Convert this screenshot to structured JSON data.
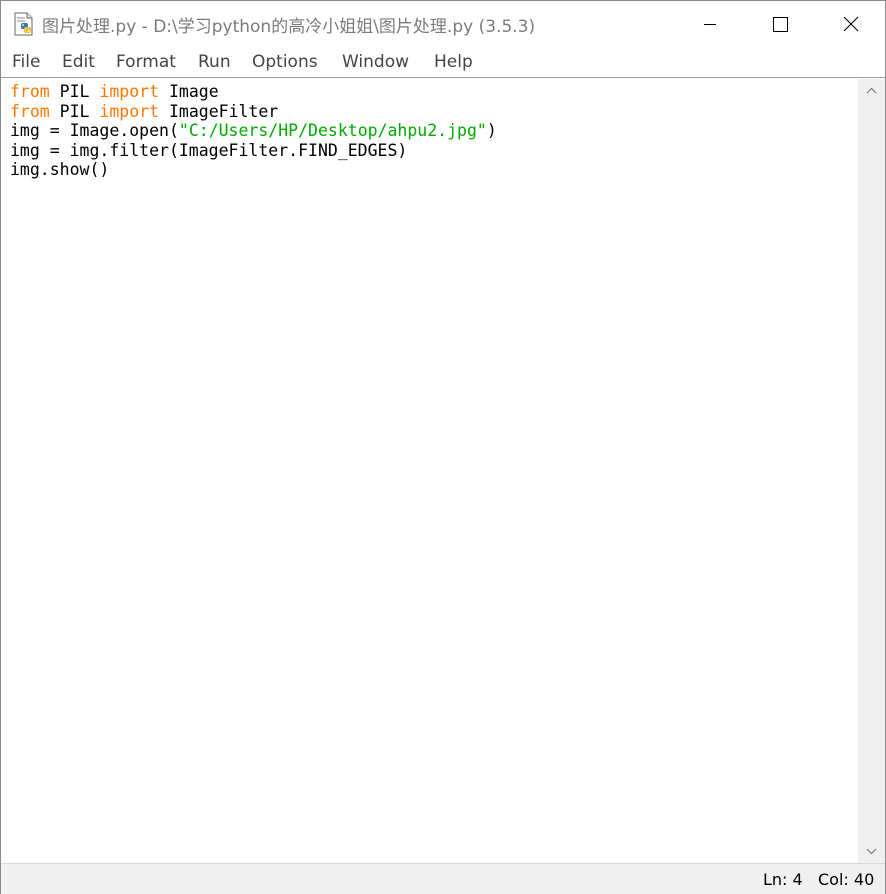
{
  "window": {
    "title": "图片处理.py - D:\\学习python的高冷小姐姐\\图片处理.py (3.5.3)",
    "app_icon": "python-idle-file-icon",
    "controls": {
      "minimize_icon": "minimize-icon",
      "maximize_icon": "maximize-icon",
      "close_icon": "close-icon"
    }
  },
  "menu": {
    "items": [
      "File",
      "Edit",
      "Format",
      "Run",
      "Options",
      "Window",
      "Help"
    ]
  },
  "editor": {
    "lines": [
      [
        {
          "t": "from",
          "c": "kw"
        },
        {
          "t": " PIL ",
          "c": ""
        },
        {
          "t": "import",
          "c": "kw"
        },
        {
          "t": " Image",
          "c": ""
        }
      ],
      [
        {
          "t": "from",
          "c": "kw"
        },
        {
          "t": " PIL ",
          "c": ""
        },
        {
          "t": "import",
          "c": "kw"
        },
        {
          "t": " ImageFilter",
          "c": ""
        }
      ],
      [
        {
          "t": "img = Image.open(",
          "c": ""
        },
        {
          "t": "\"C:/Users/HP/Desktop/ahpu2.jpg\"",
          "c": "str"
        },
        {
          "t": ")",
          "c": ""
        }
      ],
      [
        {
          "t": "img = img.filter(ImageFilter.FIND_EDGES)",
          "c": ""
        }
      ],
      [
        {
          "t": "img.show()",
          "c": ""
        }
      ]
    ],
    "syntax_colors": {
      "keyword": "#ff7700",
      "string": "#00aa00",
      "default": "#000000"
    }
  },
  "scrollbar": {
    "up_icon": "scroll-up-arrow-icon",
    "down_icon": "scroll-down-arrow-icon"
  },
  "status": {
    "ln": "Ln: 4",
    "col": "Col: 40"
  }
}
